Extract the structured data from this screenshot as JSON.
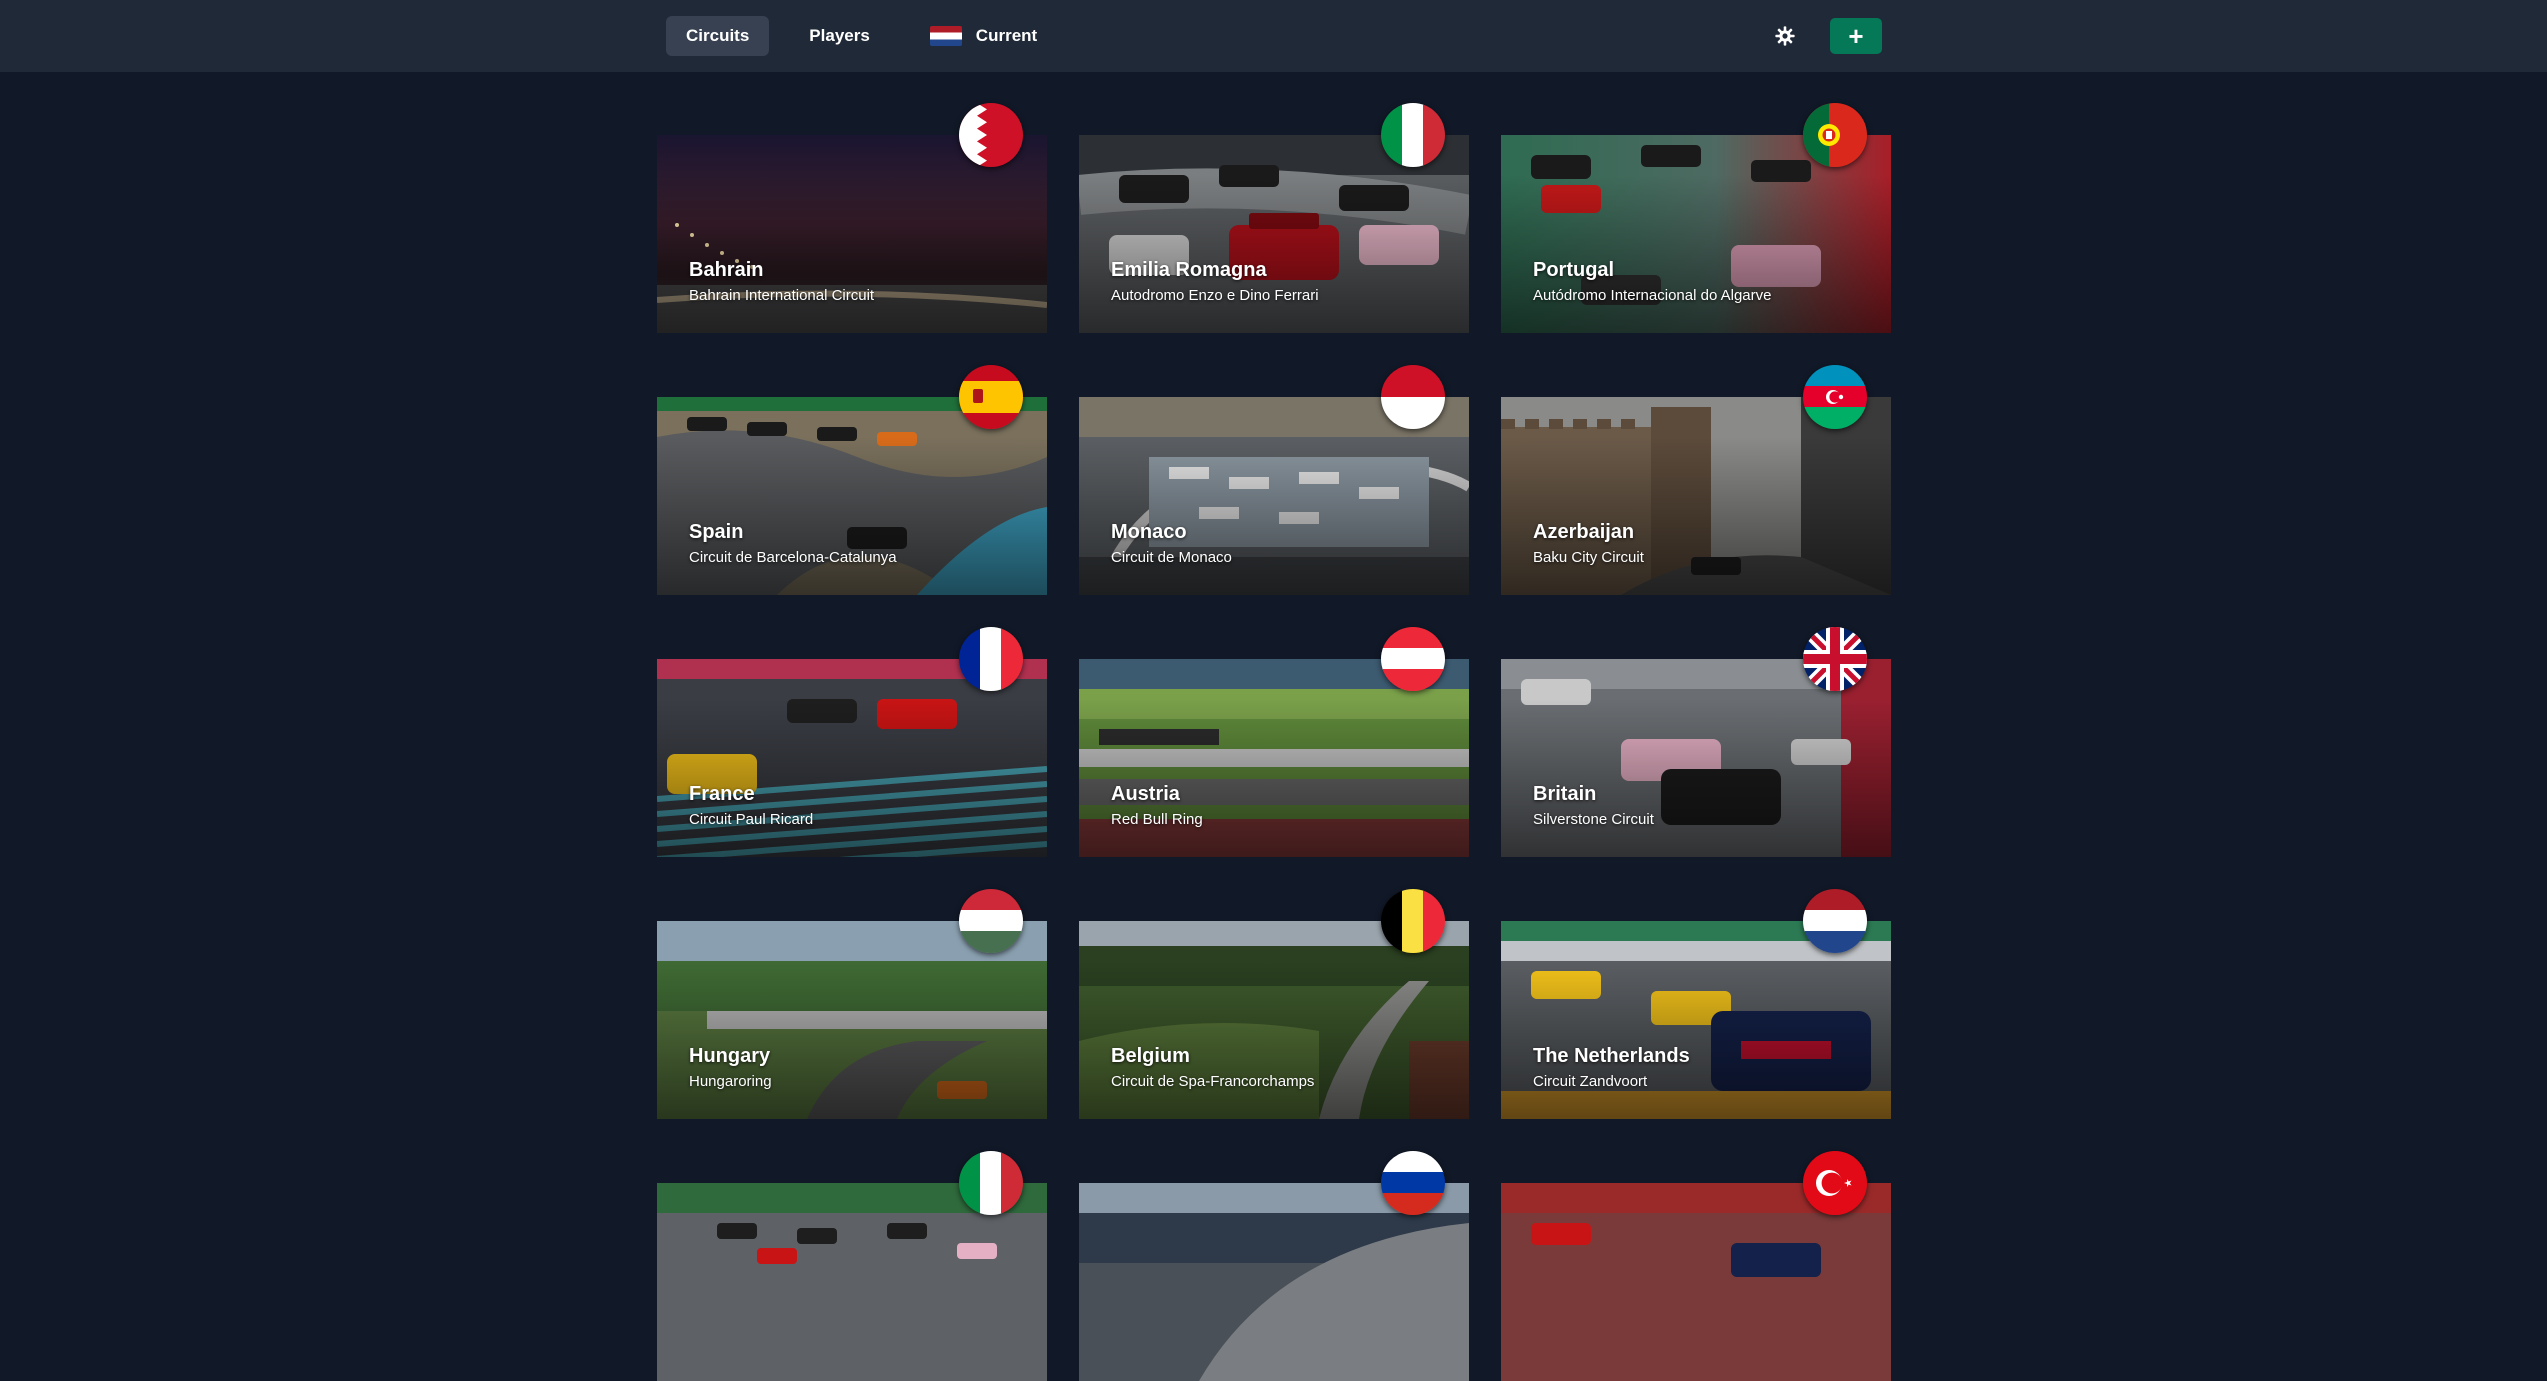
{
  "nav": {
    "tabs": [
      {
        "label": "Circuits"
      },
      {
        "label": "Players"
      },
      {
        "label": "Current"
      }
    ],
    "settings_icon": "gear-icon",
    "add_label": "+"
  },
  "colors": {
    "background": "#111827",
    "navbar": "#1f2937",
    "active_tab": "#374151",
    "add_button": "#047857"
  },
  "circuits": [
    {
      "name": "Bahrain",
      "circuit": "Bahrain International Circuit",
      "flag": "bahrain-flag-icon"
    },
    {
      "name": "Emilia Romagna",
      "circuit": "Autodromo Enzo e Dino Ferrari",
      "flag": "italy-flag-icon"
    },
    {
      "name": "Portugal",
      "circuit": "Autódromo Internacional do Algarve",
      "flag": "portugal-flag-icon"
    },
    {
      "name": "Spain",
      "circuit": "Circuit de Barcelona-Catalunya",
      "flag": "spain-flag-icon"
    },
    {
      "name": "Monaco",
      "circuit": "Circuit de Monaco",
      "flag": "monaco-flag-icon"
    },
    {
      "name": "Azerbaijan",
      "circuit": "Baku City Circuit",
      "flag": "azerbaijan-flag-icon"
    },
    {
      "name": "France",
      "circuit": "Circuit Paul Ricard",
      "flag": "france-flag-icon"
    },
    {
      "name": "Austria",
      "circuit": "Red Bull Ring",
      "flag": "austria-flag-icon"
    },
    {
      "name": "Britain",
      "circuit": "Silverstone Circuit",
      "flag": "uk-flag-icon"
    },
    {
      "name": "Hungary",
      "circuit": "Hungaroring",
      "flag": "hungary-flag-icon"
    },
    {
      "name": "Belgium",
      "circuit": "Circuit de Spa-Francorchamps",
      "flag": "belgium-flag-icon"
    },
    {
      "name": "The Netherlands",
      "circuit": "Circuit Zandvoort",
      "flag": "netherlands-flag-icon"
    },
    {
      "name": "",
      "circuit": "",
      "flag": "italy-flag-icon"
    },
    {
      "name": "",
      "circuit": "",
      "flag": "russia-flag-icon"
    },
    {
      "name": "",
      "circuit": "",
      "flag": "turkey-flag-icon"
    }
  ]
}
